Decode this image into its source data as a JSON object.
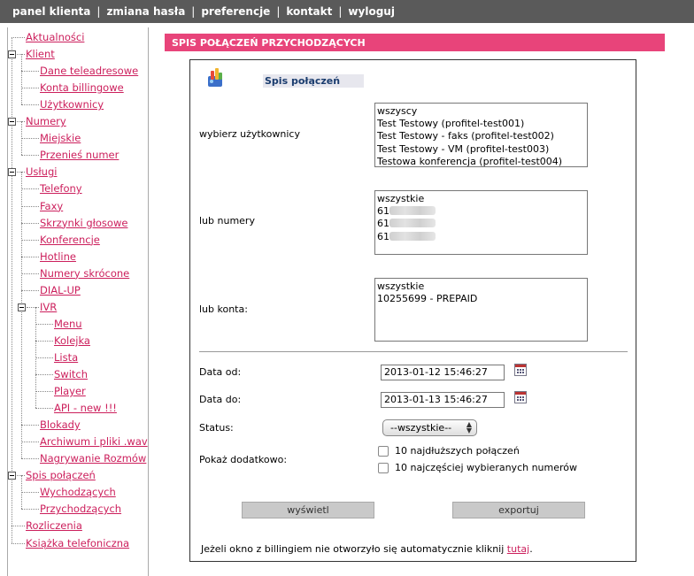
{
  "topnav": [
    "panel klienta",
    "zmiana hasła",
    "preferencje",
    "kontakt",
    "wyloguj"
  ],
  "topnav_separator": "|",
  "sidebar": [
    {
      "label": "Aktualności",
      "level": 0
    },
    {
      "label": "Klient",
      "level": 0,
      "expanded": true
    },
    {
      "label": "Dane teleadresowe",
      "level": 1
    },
    {
      "label": "Konta billingowe",
      "level": 1
    },
    {
      "label": "Użytkownicy",
      "level": 1
    },
    {
      "label": "Numery",
      "level": 0,
      "expanded": true
    },
    {
      "label": "Miejskie",
      "level": 1
    },
    {
      "label": "Przenieś numer",
      "level": 1
    },
    {
      "label": "Usługi",
      "level": 0,
      "expanded": true
    },
    {
      "label": "Telefony",
      "level": 1
    },
    {
      "label": "Faxy",
      "level": 1
    },
    {
      "label": "Skrzynki głosowe",
      "level": 1
    },
    {
      "label": "Konferencje",
      "level": 1
    },
    {
      "label": "Hotline",
      "level": 1
    },
    {
      "label": "Numery skrócone",
      "level": 1
    },
    {
      "label": "DIAL-UP",
      "level": 1
    },
    {
      "label": "IVR",
      "level": 1,
      "expanded": true
    },
    {
      "label": "Menu",
      "level": 2
    },
    {
      "label": "Kolejka",
      "level": 2
    },
    {
      "label": "Lista",
      "level": 2
    },
    {
      "label": "Switch",
      "level": 2
    },
    {
      "label": "Player",
      "level": 2
    },
    {
      "label": "API - new !!!",
      "level": 2
    },
    {
      "label": "Blokady",
      "level": 1
    },
    {
      "label": "Archiwum i pliki .wav",
      "level": 1
    },
    {
      "label": "Nagrywanie Rozmów",
      "level": 1
    },
    {
      "label": "Spis połączeń",
      "level": 0,
      "expanded": true
    },
    {
      "label": "Wychodzących",
      "level": 1
    },
    {
      "label": "Przychodzących",
      "level": 1
    },
    {
      "label": "Rozliczenia",
      "level": 0
    },
    {
      "label": "Książka telefoniczna",
      "level": 0
    }
  ],
  "section_header": "SPIS POŁĄCZEŃ PRZYCHODZĄCYCH",
  "panel": {
    "title": "Spis połączeń",
    "users_label": "wybierz użytkownicy",
    "users_options": [
      "wszyscy",
      "Test Testowy (profitel-test001)",
      "Test Testowy - faks (profitel-test002)",
      "Test Testowy - VM (profitel-test003)",
      "Testowa konferencja (profitel-test004)"
    ],
    "numbers_label": "lub numery",
    "numbers_options": [
      {
        "text": "wszystkie",
        "redacted": false
      },
      {
        "text": "61",
        "redacted": true
      },
      {
        "text": "61",
        "redacted": true
      },
      {
        "text": "61",
        "redacted": true
      }
    ],
    "accounts_label": "lub konta:",
    "accounts_options": [
      "wszystkie",
      "10255699 - PREPAID"
    ],
    "date_from_label": "Data od:",
    "date_from_value": "2013-01-12 15:46:27",
    "date_to_label": "Data do:",
    "date_to_value": "2013-01-13 15:46:27",
    "status_label": "Status:",
    "status_value": "--wszystkie--",
    "extra_label": "Pokaż dodatkowo:",
    "extra_options": [
      {
        "label": "10 najdłuższych połączeń",
        "checked": false
      },
      {
        "label": "10 najczęściej wybieranych numerów",
        "checked": false
      }
    ],
    "show_button": "wyświetl",
    "export_button": "exportuj",
    "footnote_text": "Jeżeli okno z billingiem nie otworzyło się automatycznie kliknij",
    "footnote_link": "tutaj",
    "footnote_end": "."
  }
}
